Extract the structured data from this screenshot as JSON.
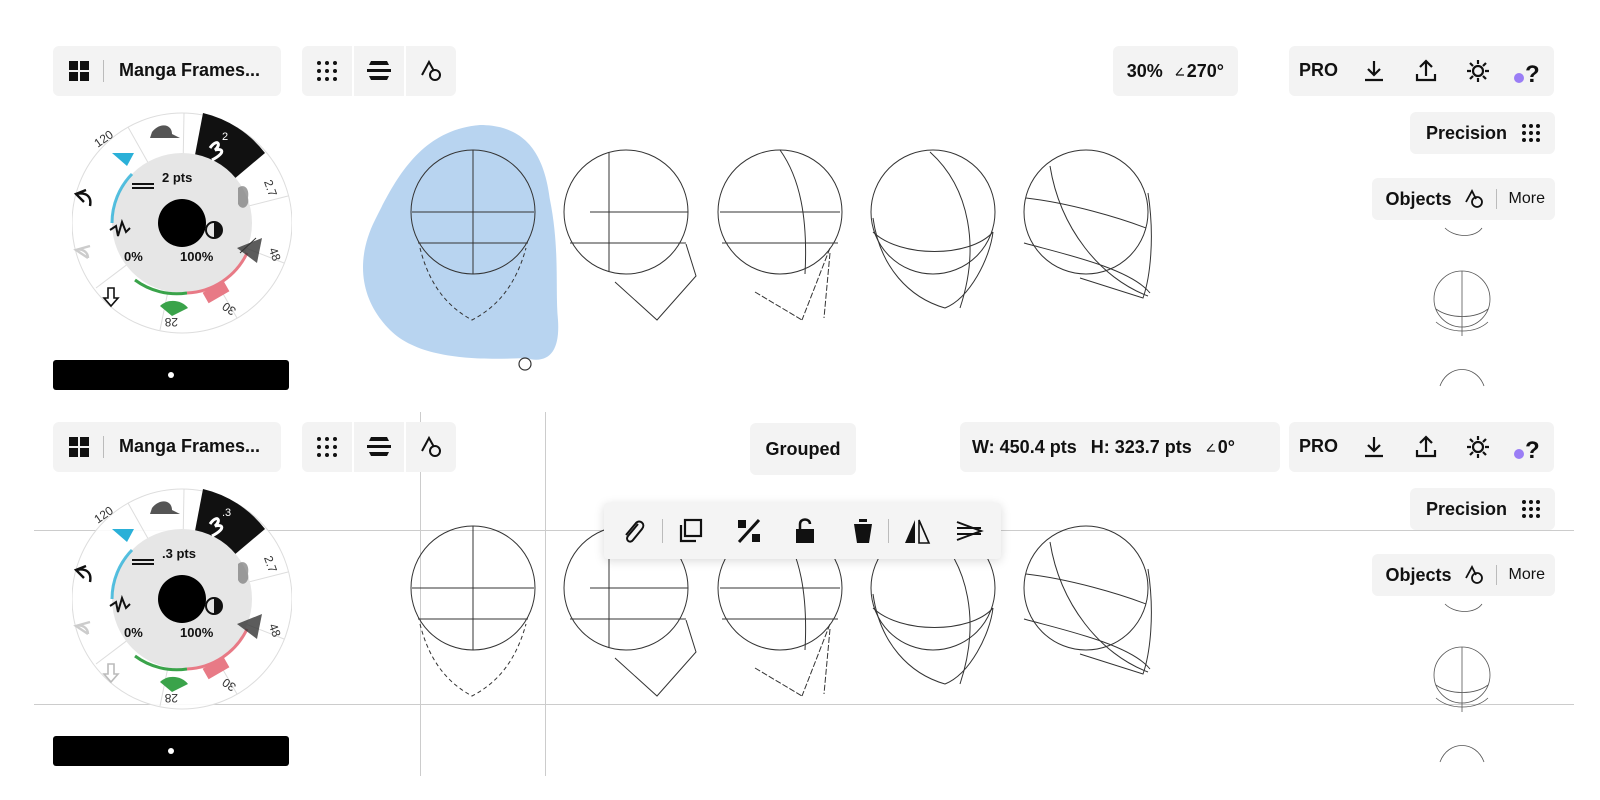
{
  "top": {
    "doc_title": "Manga Frames...",
    "zoom": "30%",
    "rotation": "270°",
    "pro_label": "PRO",
    "precision_label": "Precision",
    "objects_label": "Objects",
    "more_label": "More",
    "brush": {
      "size": "2 pts",
      "opacity_min": "0%",
      "opacity_max": "100%",
      "active_tool_size": "2",
      "tool_sizes": [
        "120",
        "2.7",
        "48",
        "30",
        "28"
      ]
    }
  },
  "bottom": {
    "doc_title": "Manga Frames...",
    "width": "W: 450.4 pts",
    "height": "H: 323.7 pts",
    "rotation": "0°",
    "pro_label": "PRO",
    "precision_label": "Precision",
    "objects_label": "Objects",
    "more_label": "More",
    "grouped_label": "Grouped",
    "brush": {
      "size": ".3 pts",
      "opacity_min": "0%",
      "opacity_max": "100%",
      "active_tool_size": ".3",
      "tool_sizes": [
        "120",
        "2.7",
        "48",
        "30",
        "28"
      ]
    },
    "context_toolbar": [
      "paperclip-icon",
      "duplicate-icon",
      "percent-icon",
      "unlock-icon",
      "trash-icon",
      "flip-icon",
      "distribute-icon"
    ]
  },
  "colors": {
    "selection_fill": "#b8d4f0",
    "accent_purple": "#9a7df5",
    "chip_bg": "#f3f3f3",
    "eraser_pink": "#e87a86",
    "marker_green": "#3aa34a",
    "pen_blue": "#2ab0d8"
  }
}
